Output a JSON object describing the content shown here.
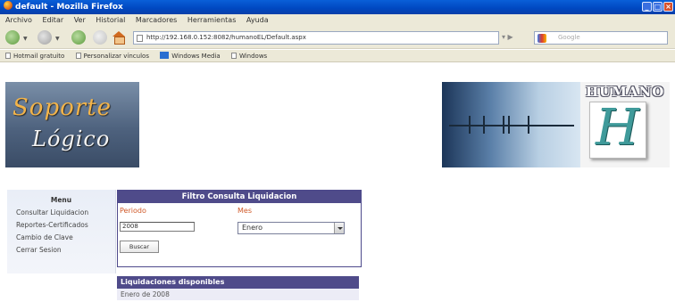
{
  "browser": {
    "title": "default - Mozilla Firefox",
    "menu": [
      "Archivo",
      "Editar",
      "Ver",
      "Historial",
      "Marcadores",
      "Herramientas",
      "Ayuda"
    ],
    "url": "http://192.168.0.152:8082/humanoEL/Default.aspx",
    "search_placeholder": "Google",
    "bookmarks": [
      "Hotmail gratuito",
      "Personalizar vínculos",
      "Windows Media",
      "Windows"
    ]
  },
  "banner": {
    "logo_line1": "Soporte",
    "logo_line2": "Lógico",
    "brand": "HUMANO",
    "brand_mark": "H"
  },
  "left_menu": {
    "title": "Menu",
    "items": [
      "Consultar Liquidacion",
      "Reportes-Certificados",
      "Cambio de Clave",
      "Cerrar Sesion"
    ]
  },
  "filter": {
    "title": "Filtro Consulta Liquidacion",
    "periodo_label": "Periodo",
    "periodo_value": "2008",
    "mes_label": "Mes",
    "mes_value": "Enero",
    "button_label": "Buscar"
  },
  "results": {
    "header": "Liquidaciones disponibles",
    "rows": [
      "Enero de 2008"
    ]
  }
}
